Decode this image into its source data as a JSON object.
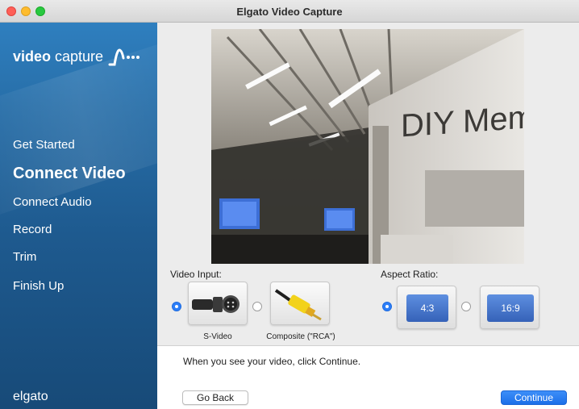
{
  "window": {
    "title": "Elgato Video Capture"
  },
  "sidebar": {
    "logo_bold": "video",
    "logo_light": "capture",
    "nav": [
      {
        "label": "Get Started",
        "active": false
      },
      {
        "label": "Connect Video",
        "active": true
      },
      {
        "label": "Connect Audio",
        "active": false
      },
      {
        "label": "Record",
        "active": false
      },
      {
        "label": "Trim",
        "active": false
      },
      {
        "label": "Finish Up",
        "active": false
      }
    ],
    "brand": "elgato"
  },
  "preview": {
    "sign_text": "DIY Memor"
  },
  "video_input": {
    "label": "Video Input:",
    "options": [
      {
        "label": "S-Video",
        "selected": true
      },
      {
        "label": "Composite (\"RCA\")",
        "selected": false
      }
    ]
  },
  "aspect_ratio": {
    "label": "Aspect Ratio:",
    "options": [
      {
        "label": "4:3",
        "selected": true
      },
      {
        "label": "16:9",
        "selected": false
      }
    ]
  },
  "footer": {
    "hint": "When you see your video, click Continue.",
    "back_label": "Go Back",
    "continue_label": "Continue"
  },
  "colors": {
    "accent": "#2c7ef8",
    "sidebar": "#1e5a8f"
  }
}
